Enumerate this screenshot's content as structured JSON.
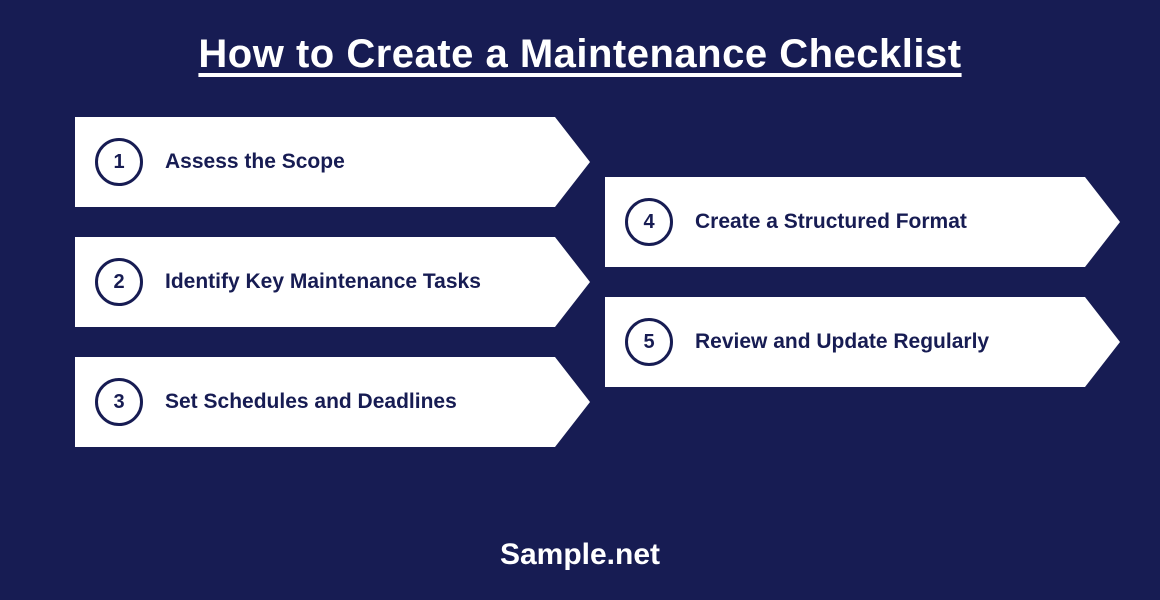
{
  "title": "How to Create a Maintenance Checklist",
  "footer": "Sample.net",
  "colors": {
    "background": "#171c53",
    "card": "#ffffff",
    "text_dark": "#171c53",
    "text_light": "#ffffff"
  },
  "steps_left": [
    {
      "num": "1",
      "label": "Assess the Scope"
    },
    {
      "num": "2",
      "label": "Identify Key Maintenance Tasks"
    },
    {
      "num": "3",
      "label": "Set Schedules and Deadlines"
    }
  ],
  "steps_right": [
    {
      "num": "4",
      "label": "Create a Structured Format"
    },
    {
      "num": "5",
      "label": "Review and Update Regularly"
    }
  ]
}
